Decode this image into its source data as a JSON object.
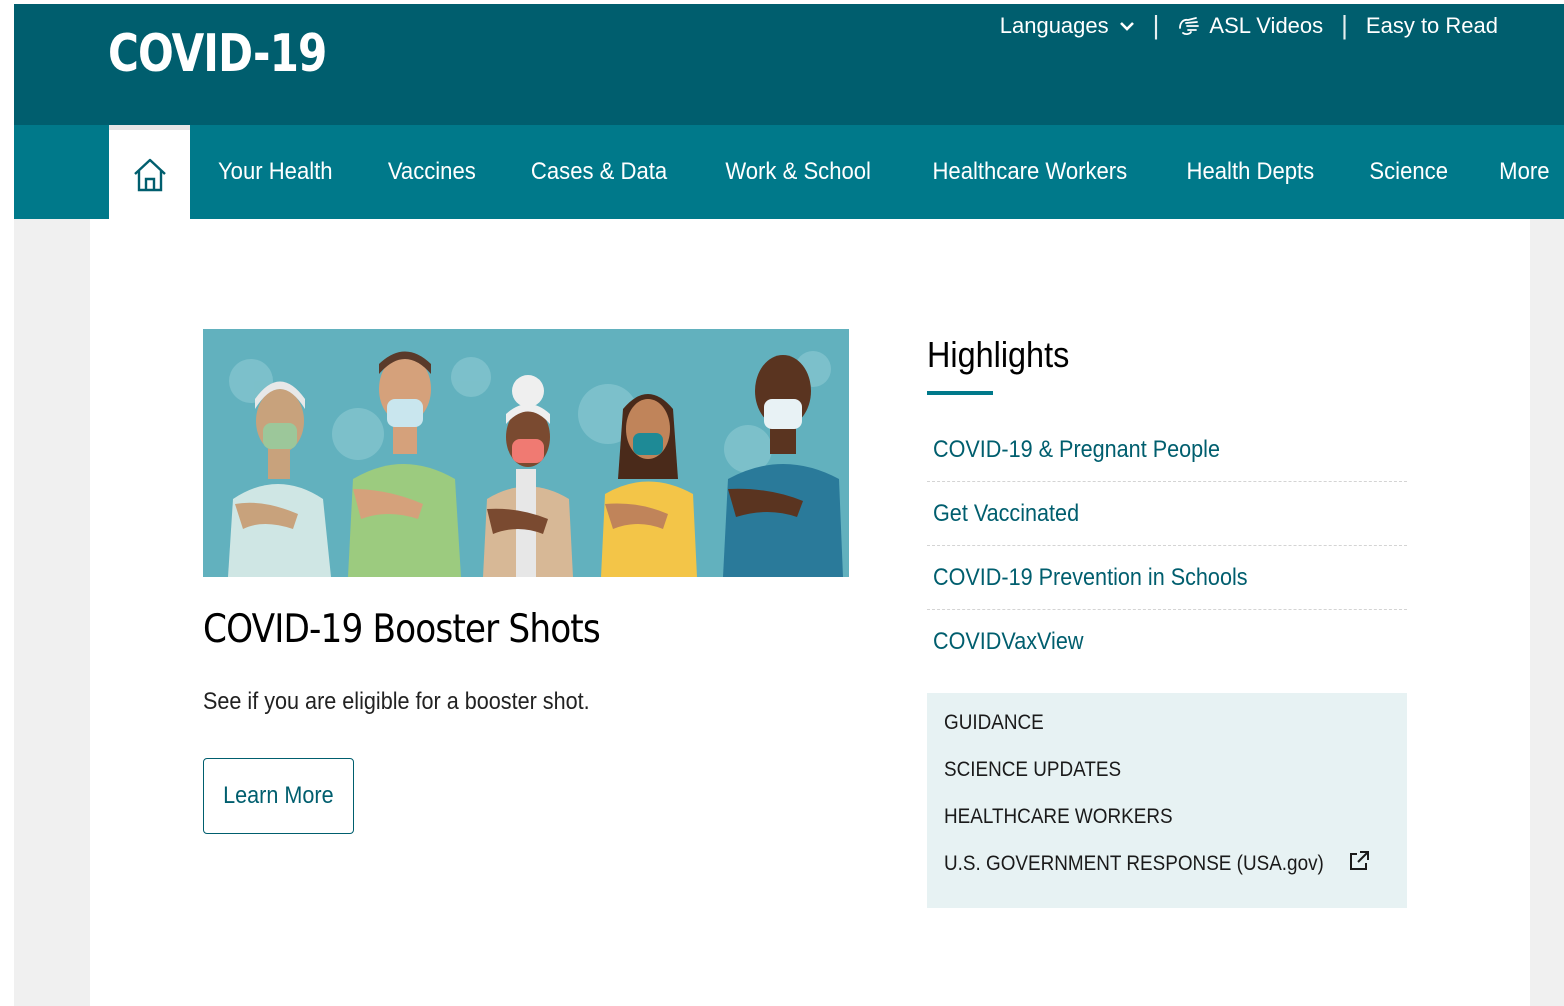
{
  "header": {
    "site_title": "COVID-19",
    "utility": {
      "languages": "Languages",
      "asl_videos": "ASL Videos",
      "easy_to_read": "Easy to Read",
      "separator": "|"
    }
  },
  "nav": {
    "home_icon": "home-icon",
    "items": [
      "Your Health",
      "Vaccines",
      "Cases & Data",
      "Work & School",
      "Healthcare Workers",
      "Health Depts",
      "Science",
      "More"
    ]
  },
  "hero": {
    "title": "COVID-19 Booster Shots",
    "description": "See if you are eligible for a booster shot.",
    "button_label": "Learn More",
    "image_bg_color": "#62b1be"
  },
  "highlights": {
    "title": "Highlights",
    "links": [
      "COVID-19 & Pregnant People",
      "Get Vaccinated",
      "COVID-19 Prevention in Schools",
      "COVIDVaxView"
    ]
  },
  "quick_links": {
    "items": [
      "GUIDANCE",
      "SCIENCE UPDATES",
      "HEALTHCARE WORKERS",
      "U.S. GOVERNMENT RESPONSE (USA.gov)"
    ],
    "external_icon": "external-link-icon"
  },
  "colors": {
    "header_dark": "#005e6e",
    "nav_teal": "#00798a",
    "link": "#005e6e",
    "quick_box_bg": "#e7f2f3"
  }
}
